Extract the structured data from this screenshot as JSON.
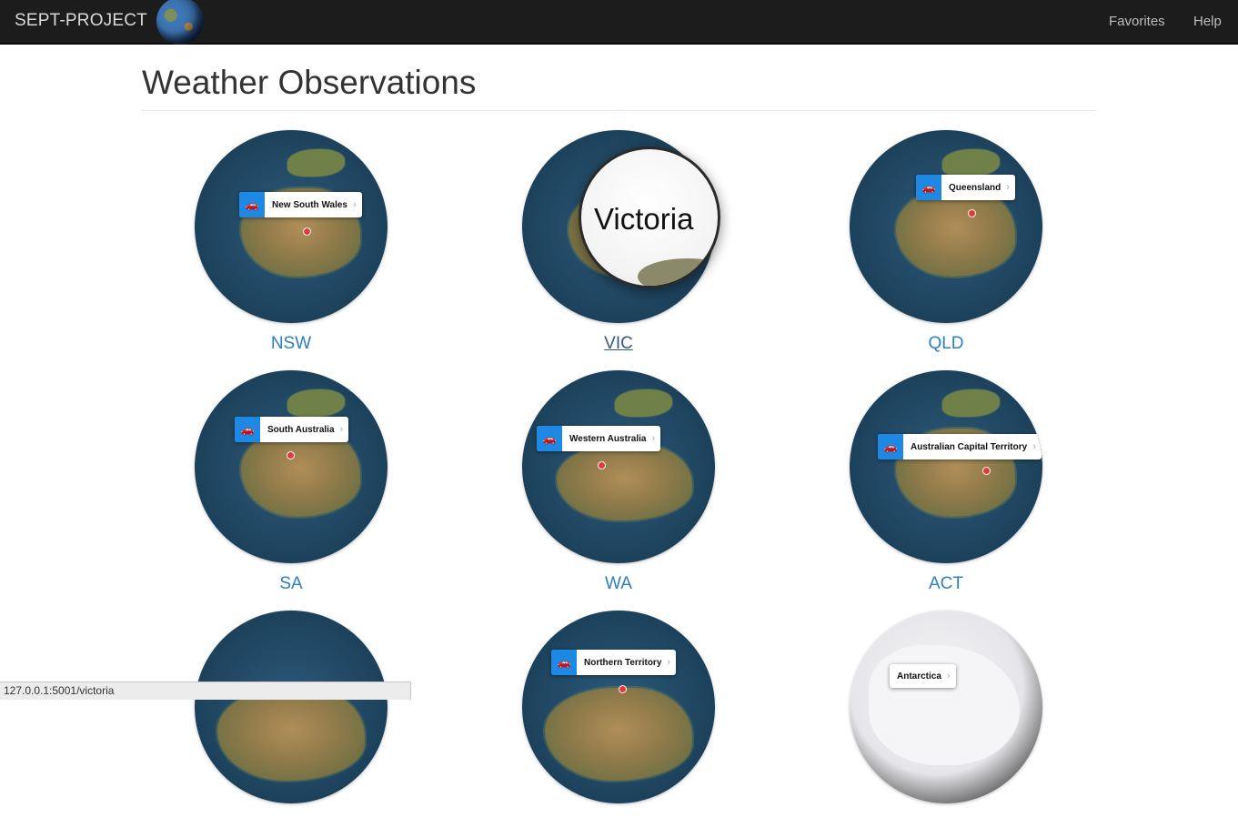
{
  "navbar": {
    "brand": "SEPT-PROJECT",
    "links": [
      "Favorites",
      "Help"
    ]
  },
  "page": {
    "title": "Weather Observations"
  },
  "tiles": [
    {
      "code": "NSW",
      "callout": "New South Wales"
    },
    {
      "code": "VIC",
      "callout": "",
      "magnifier_text": "Victoria"
    },
    {
      "code": "QLD",
      "callout": "Queensland"
    },
    {
      "code": "SA",
      "callout": "South Australia"
    },
    {
      "code": "WA",
      "callout": "Western Australia"
    },
    {
      "code": "ACT",
      "callout": "Australian Capital Territory"
    },
    {
      "code": "",
      "callout": ""
    },
    {
      "code": "",
      "callout": "Northern Territory"
    },
    {
      "code": "",
      "callout": "Antarctica"
    }
  ],
  "status_bar": {
    "url": "127.0.0.1:5001/victoria"
  },
  "colors": {
    "navbar_bg": "#1c1c1c",
    "link_blue": "#2d7dc7",
    "callout_blue": "#1e88e5",
    "pin_red": "#e53935"
  },
  "icons": {
    "callout_icon": "car-icon",
    "callout_chevron": "chevron-right-icon"
  }
}
